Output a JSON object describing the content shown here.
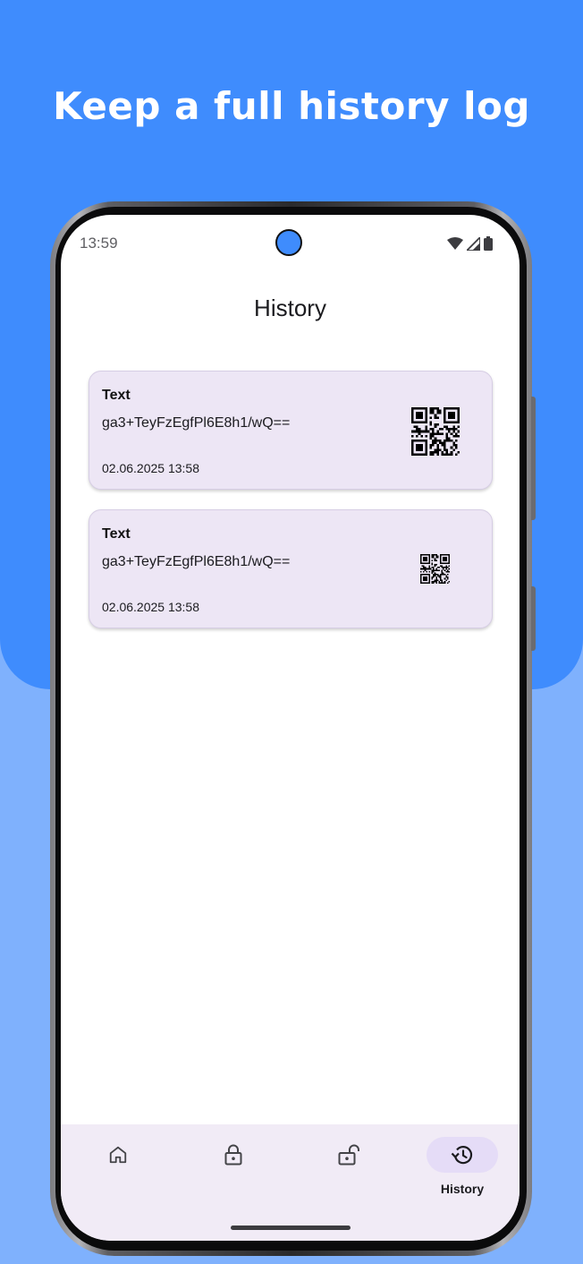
{
  "promo": {
    "headline": "Keep a full history log",
    "colors": {
      "background_top": "#3f8cfd",
      "background_bottom": "#7fb1fd",
      "camera": "#3f8cfd"
    }
  },
  "status_bar": {
    "time": "13:59",
    "icons": [
      "wifi-icon",
      "cellular-signal-icon",
      "battery-icon"
    ]
  },
  "screen": {
    "title": "History"
  },
  "history": {
    "items": [
      {
        "type": "Text",
        "value": "ga3+TeyFzEgfPl6E8h1/wQ==",
        "date": "02.06.2025 13:58",
        "icon": "qr-code"
      },
      {
        "type": "Text",
        "value": "ga3+TeyFzEgfPl6E8h1/wQ==",
        "date": "02.06.2025 13:58",
        "icon": "qr-code"
      }
    ],
    "colors": {
      "card_background": "#ede6f5",
      "card_border": "#d6cde4"
    }
  },
  "bottom_nav": {
    "items": [
      {
        "id": "home",
        "icon": "home-icon",
        "label": ""
      },
      {
        "id": "encrypt",
        "icon": "lock-icon",
        "label": ""
      },
      {
        "id": "decrypt",
        "icon": "unlock-icon",
        "label": ""
      },
      {
        "id": "history",
        "icon": "history-icon",
        "label": "History"
      }
    ],
    "active": "history",
    "colors": {
      "background": "#f1ebf6",
      "active_pill": "#e5dcf7"
    }
  }
}
